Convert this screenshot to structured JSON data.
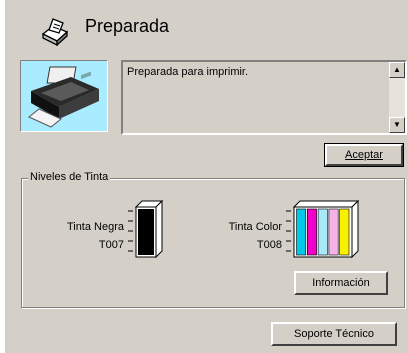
{
  "status": {
    "title": "Preparada",
    "message": "Preparada para imprimir.",
    "icon": "printer-icon"
  },
  "buttons": {
    "accept": "Aceptar",
    "info": "Información",
    "support": "Soporte Técnico"
  },
  "ink": {
    "group_label": "Niveles de Tinta",
    "black": {
      "label": "Tinta Negra",
      "code": "T007",
      "level": 1.0,
      "color": "#000000"
    },
    "color": {
      "label": "Tinta Color",
      "code": "T008",
      "cartridges": [
        {
          "name": "cyan",
          "color": "#00c8e8",
          "level": 1.0
        },
        {
          "name": "magenta",
          "color": "#f000c8",
          "level": 1.0
        },
        {
          "name": "light-cyan",
          "color": "#a8e8f8",
          "level": 1.0
        },
        {
          "name": "light-magenta",
          "color": "#f8b0e8",
          "level": 1.0
        },
        {
          "name": "yellow",
          "color": "#f8f000",
          "level": 1.0
        }
      ]
    }
  }
}
